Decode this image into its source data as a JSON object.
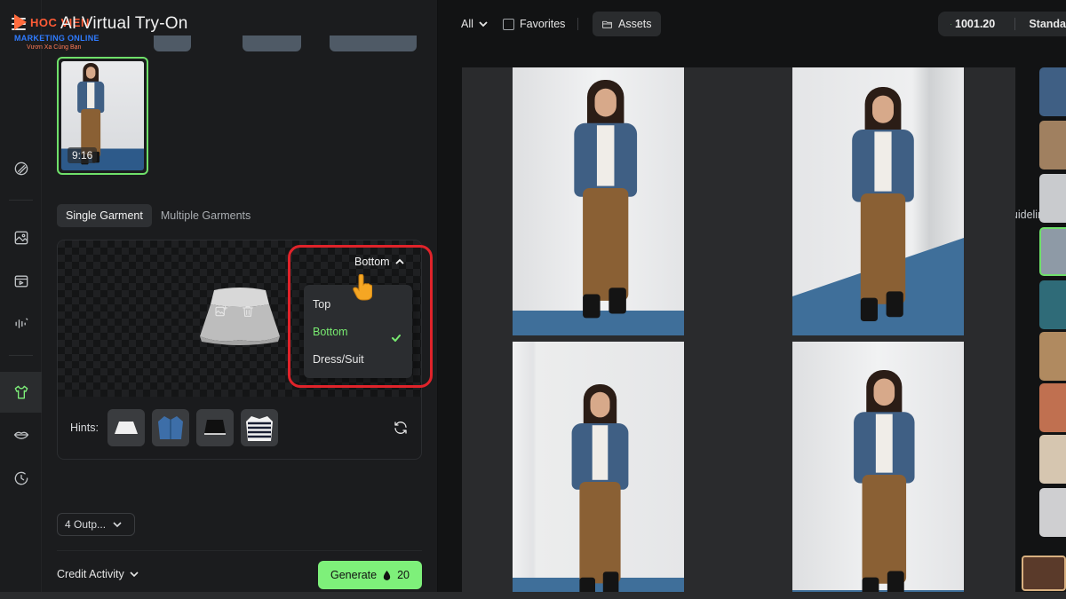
{
  "app": {
    "title": "AI Virtual Try-On",
    "logo_text": "HOC VIEN",
    "logo_sub1": "MARKETING ONLINE",
    "logo_sub2": "Vươn Xa Cùng Bạn"
  },
  "reference": {
    "ratio": "9:16"
  },
  "garment_tabs": [
    {
      "label": "Single Garment",
      "active": true
    },
    {
      "label": "Multiple Garments",
      "active": false
    }
  ],
  "guideline_label": "Guideline",
  "garment": {
    "type_selected": "Bottom",
    "type_options": [
      {
        "label": "Top",
        "selected": false
      },
      {
        "label": "Bottom",
        "selected": true
      },
      {
        "label": "Dress/Suit",
        "selected": false
      }
    ],
    "hints_label": "Hints:"
  },
  "outputs_label": "4 Outp...",
  "credit_activity_label": "Credit Activity",
  "generate": {
    "label": "Generate",
    "cost": "20"
  },
  "topbar": {
    "filter_label": "All",
    "favorites_label": "Favorites",
    "assets_label": "Assets",
    "credits": "1001.20",
    "plan": "Standa"
  },
  "colors": {
    "accent": "#7ef07a",
    "highlight_outline": "#e0232a",
    "background": "#121314",
    "panel": "#1b1c1e"
  },
  "icons": {
    "rail": [
      "brush-icon",
      "image-icon",
      "video-icon",
      "audio-icon",
      "shirt-icon",
      "lips-icon",
      "history-icon"
    ]
  }
}
